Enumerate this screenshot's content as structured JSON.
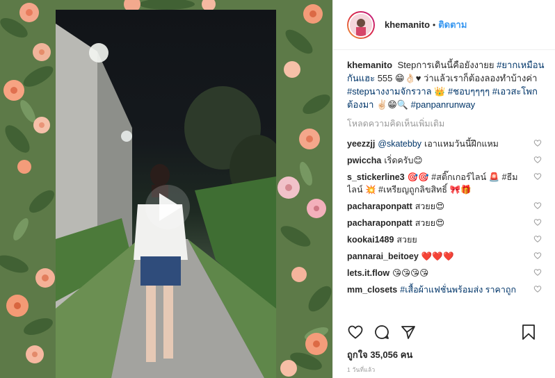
{
  "post": {
    "username": "khemanito",
    "separator": "•",
    "follow_label": "ติดตาม",
    "caption": {
      "username": "khemanito",
      "text_1": "Stepการเดินนี้คือยังงายย",
      "tag_1": "#ยากเหมือนกันแฮะ",
      "text_2": "555 😁👌🏻♥ ว่าแล้วเราก็ต้องลองทำบ้างค่า",
      "tag_2": "#stepนางงามจักรวาล",
      "text_3": "👑",
      "tag_3": "#ชอบๆๆๆๆ",
      "tag_4": "#เอวสะโพกต้องมา",
      "text_4": "✌🏻😁🔍",
      "tag_5": "#panpanrunway"
    },
    "load_more_label": "โหลดความคิดเห็นเพิ่มเติม",
    "comments": [
      {
        "user": "yeezzjj",
        "mention": "@skatebby",
        "text": "เอาแหมวันนี้ฝึกแหม"
      },
      {
        "user": "pwiccha",
        "mention": "",
        "text": "เริ่ดครับ😊"
      },
      {
        "user": "s_stickerline3",
        "mention": "",
        "text": "🎯🎯 #สติ๊กเกอร์ไลน์ 🚨 #ธีมไลน์ 💥 #เหรียญถูกลิขสิทธิ์ 🎀🎁"
      },
      {
        "user": "pacharaponpatt",
        "mention": "",
        "text": "สวยย😍"
      },
      {
        "user": "pacharaponpatt",
        "mention": "",
        "text": "สวยย😍"
      },
      {
        "user": "kookai1489",
        "mention": "",
        "text": "สวยย"
      },
      {
        "user": "pannarai_beitoey",
        "mention": "",
        "text": "❤️❤️❤️"
      },
      {
        "user": "lets.it.flow",
        "mention": "",
        "text": "😘😘😘😘"
      },
      {
        "user": "mm_closets",
        "mention": "",
        "text": "#เสื้อผ้าแฟชั่นพร้อมส่ง ราคาถูก"
      }
    ],
    "likes_text": "ถูกใจ 35,056 คน",
    "time_text": "1 วันที่แล้ว",
    "icons": {
      "like": "heart-icon",
      "comment": "comment-icon",
      "share": "share-icon",
      "save": "bookmark-icon",
      "play": "play-icon"
    },
    "colors": {
      "link": "#003569",
      "follow": "#3897f0",
      "muted": "#999999"
    }
  }
}
